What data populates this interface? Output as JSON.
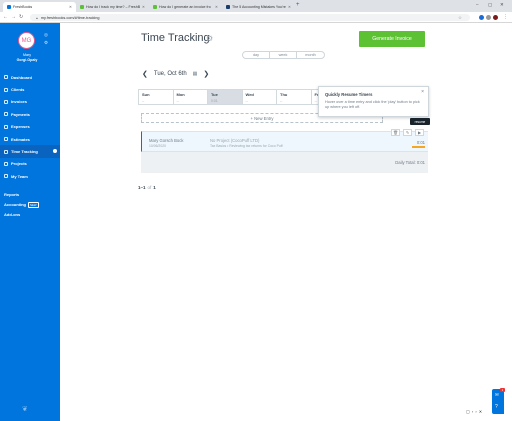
{
  "browser": {
    "tabs": [
      {
        "label": "FreshBooks",
        "color": "#0075dd",
        "active": true
      },
      {
        "label": "How do I track my time? – FreshBo",
        "color": "#5dc233",
        "active": false
      },
      {
        "label": "How do I generate an invoice fro",
        "color": "#5dc233",
        "active": false
      },
      {
        "label": "The 5 Accounting Mistakes You're",
        "color": "#1a3d6e",
        "active": false
      }
    ],
    "new_tab": "+",
    "url": "my.freshbooks.com/#/time-tracking",
    "window_controls": [
      "–",
      "▢",
      "✕"
    ]
  },
  "sidebar": {
    "avatar_initials": "MG",
    "user_line1": "Mary",
    "user_line2": "Gorgi-Opaly",
    "items": [
      {
        "label": "Dashboard",
        "active": false
      },
      {
        "label": "Clients",
        "active": false
      },
      {
        "label": "Invoices",
        "active": false
      },
      {
        "label": "Payments",
        "active": false
      },
      {
        "label": "Expenses",
        "active": false
      },
      {
        "label": "Estimates",
        "active": false
      },
      {
        "label": "Time Tracking",
        "active": true
      },
      {
        "label": "Projects",
        "active": false
      },
      {
        "label": "My Team",
        "active": false
      }
    ],
    "secondary": [
      {
        "label": "Reports",
        "badge": ""
      },
      {
        "label": "Accounting",
        "badge": "NEW"
      },
      {
        "label": "Add-ons",
        "badge": ""
      }
    ]
  },
  "header": {
    "title": "Time Tracking",
    "generate_invoice": "Generate Invoice"
  },
  "view_toggle": [
    "day",
    "week",
    "month"
  ],
  "date_nav": {
    "prev": "❮",
    "label": "Tue, Oct 6th",
    "next": "❯"
  },
  "week": [
    {
      "name": "Sun",
      "value": "--",
      "selected": false
    },
    {
      "name": "Mon",
      "value": "--",
      "selected": false
    },
    {
      "name": "Tue",
      "value": "0:01",
      "selected": true
    },
    {
      "name": "Wed",
      "value": "--",
      "selected": false
    },
    {
      "name": "Thu",
      "value": "--",
      "selected": false
    },
    {
      "name": "Fri",
      "value": "--",
      "selected": false
    }
  ],
  "new_entry": "+ New Entry",
  "popover": {
    "title": "Quickly Resume Timers",
    "text": "Hover over a time entry and click the 'play' button to pick up where you left off."
  },
  "tooltip": "resume",
  "entry": {
    "name": "Mary Gorsch Bock",
    "date": "10/06/2020",
    "project": "No Project (CocoPuff LTD)",
    "subtitle": "Tax Basics • Reviewing tax returns for Coco Puff",
    "time": "0:01"
  },
  "daily_total": "Daily Total: 0:01",
  "pager": {
    "range": "1–1",
    "of": "of",
    "total": "1"
  },
  "zoom": "100%"
}
